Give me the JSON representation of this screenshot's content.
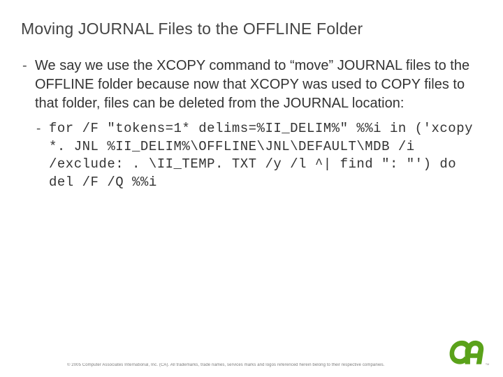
{
  "title": "Moving JOURNAL Files to the OFFLINE Folder",
  "body": {
    "para1": "We say we use the XCOPY command to “move” JOURNAL files to the OFFLINE folder because now that XCOPY was used to COPY files to that folder, files can be deleted from the JOURNAL location:",
    "code1": "for /F \"tokens=1* delims=%II_DELIM%\" %%i in ('xcopy *. JNL %II_DELIM%\\OFFLINE\\JNL\\DEFAULT\\MDB /i /exclude: . \\II_TEMP. TXT /y /l ^| find \": \"') do del /F /Q %%i"
  },
  "footer": {
    "copyright": "© 2005 Computer Associates International, Inc. (CA). All trademarks, trade names, services marks and logos referenced herein belong to their respective companies."
  },
  "logo": {
    "name": "ca-logo"
  }
}
